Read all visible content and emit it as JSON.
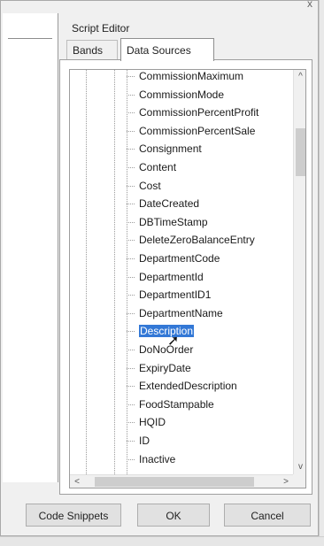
{
  "window": {
    "close_glyph": "x"
  },
  "group": {
    "title": "Script Editor"
  },
  "tabs": [
    {
      "label": "Bands"
    },
    {
      "label": "Data Sources"
    }
  ],
  "tree_items": [
    "CommissionMaximum",
    "CommissionMode",
    "CommissionPercentProfit",
    "CommissionPercentSale",
    "Consignment",
    "Content",
    "Cost",
    "DateCreated",
    "DBTimeStamp",
    "DeleteZeroBalanceEntry",
    "DepartmentCode",
    "DepartmentId",
    "DepartmentID1",
    "DepartmentName",
    "Description",
    "DoNoOrder",
    "ExpiryDate",
    "ExtendedDescription",
    "FoodStampable",
    "HQID",
    "ID",
    "Inactive"
  ],
  "selected_item": "Description",
  "scroll": {
    "up": "^",
    "down": "v",
    "left": "<",
    "right": ">"
  },
  "buttons": {
    "snippets": "Code Snippets",
    "ok": "OK",
    "cancel": "Cancel"
  },
  "colors": {
    "selection": "#3378d6",
    "window_bg": "#f0f0f0"
  }
}
